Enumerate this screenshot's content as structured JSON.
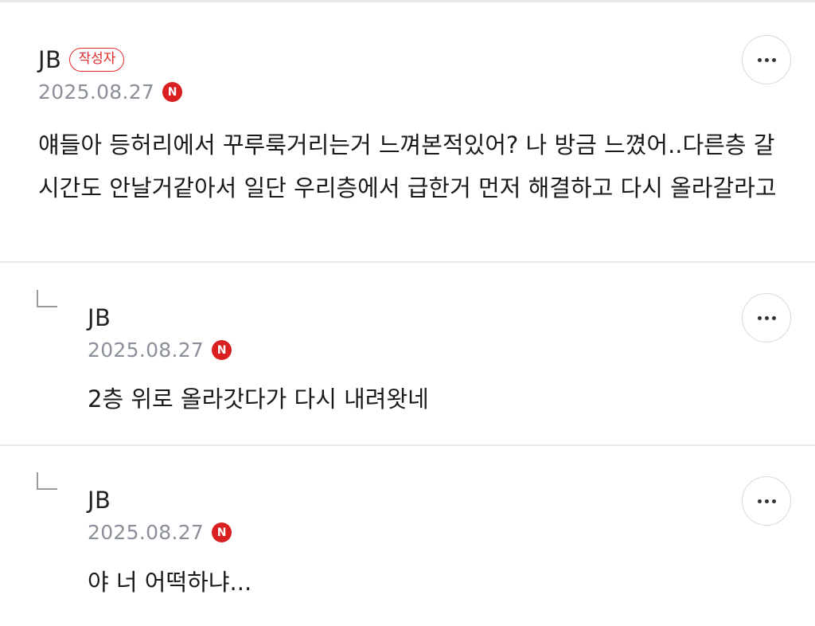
{
  "comments": [
    {
      "author": "JB",
      "badge": "작성자",
      "date": "2025.08.27",
      "source_icon": "N",
      "text": "얘들아 등허리에서 꾸루룩거리는거 느껴본적있어? 나 방금 느꼈어..다른층 갈 시간도 안날거같아서 일단 우리층에서 급한거 먼저 해결하고 다시 올라갈라고"
    },
    {
      "author": "JB",
      "date": "2025.08.27",
      "source_icon": "N",
      "text": "2층 위로 올라갓다가 다시 내려왓네"
    },
    {
      "author": "JB",
      "date": "2025.08.27",
      "source_icon": "N",
      "text": "야 너 어떡하냐..."
    }
  ],
  "colors": {
    "badge_red": "#e32a2a",
    "n_icon_red": "#d91f1f",
    "date_gray": "#8a8f99",
    "divider": "#e9e9ec"
  },
  "icons": {
    "more": "more-dots-icon",
    "reply": "reply-arrow-icon",
    "source": "naver-n-icon"
  }
}
